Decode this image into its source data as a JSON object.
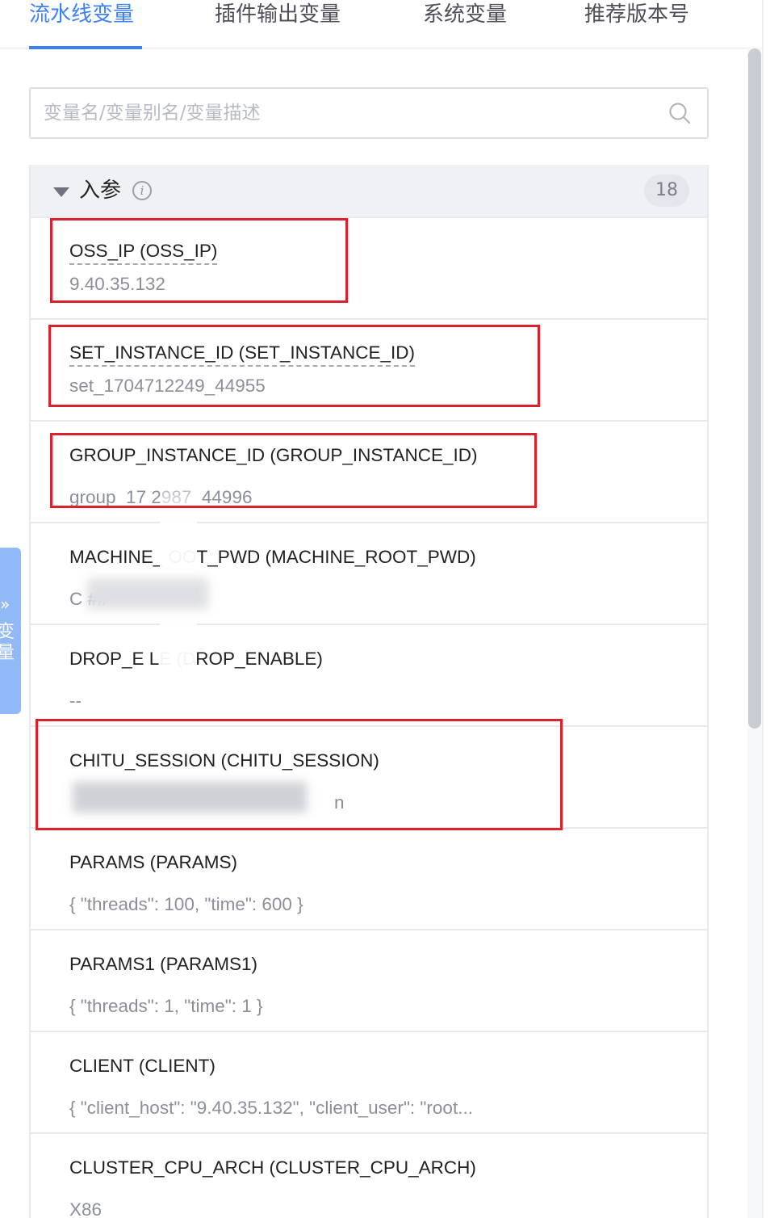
{
  "tabs": [
    {
      "label": "流水线变量",
      "active": true
    },
    {
      "label": "插件输出变量",
      "active": false
    },
    {
      "label": "系统变量",
      "active": false
    },
    {
      "label": "推荐版本号",
      "active": false
    }
  ],
  "search": {
    "placeholder": "变量名/变量别名/变量描述",
    "icon": "search-icon"
  },
  "group": {
    "title": "入参",
    "info_icon": "info-icon",
    "count": "18",
    "items": [
      {
        "name": "OSS_IP (OSS_IP)",
        "value": "9.40.35.132"
      },
      {
        "name": "SET_INSTANCE_ID (SET_INSTANCE_ID)",
        "value": "set_1704712249_44955"
      },
      {
        "name": "GROUP_INSTANCE_ID (GROUP_INSTANCE_ID)",
        "value": "group_17 2987_44996"
      },
      {
        "name": "MACHINE_ OOT_PWD (MACHINE_ROOT_PWD)",
        "value": "C ##"
      },
      {
        "name": "DROP_E LE (DROP_ENABLE)",
        "value": "--"
      },
      {
        "name": "CHITU_SESSION (CHITU_SESSION)",
        "value": "n"
      },
      {
        "name": "PARAMS (PARAMS)",
        "value": "{ \"threads\": 100, \"time\": 600 }"
      },
      {
        "name": "PARAMS1 (PARAMS1)",
        "value": "{ \"threads\": 1, \"time\": 1 }"
      },
      {
        "name": "CLIENT (CLIENT)",
        "value": "{ \"client_host\": \"9.40.35.132\", \"client_user\": \"root..."
      },
      {
        "name": "CLUSTER_CPU_ARCH (CLUSTER_CPU_ARCH)",
        "value": "X86"
      }
    ]
  },
  "side_tab": {
    "chevron": "»",
    "label": "变量"
  },
  "colors": {
    "accent": "#3c82f6",
    "highlight": "#d9222c"
  }
}
